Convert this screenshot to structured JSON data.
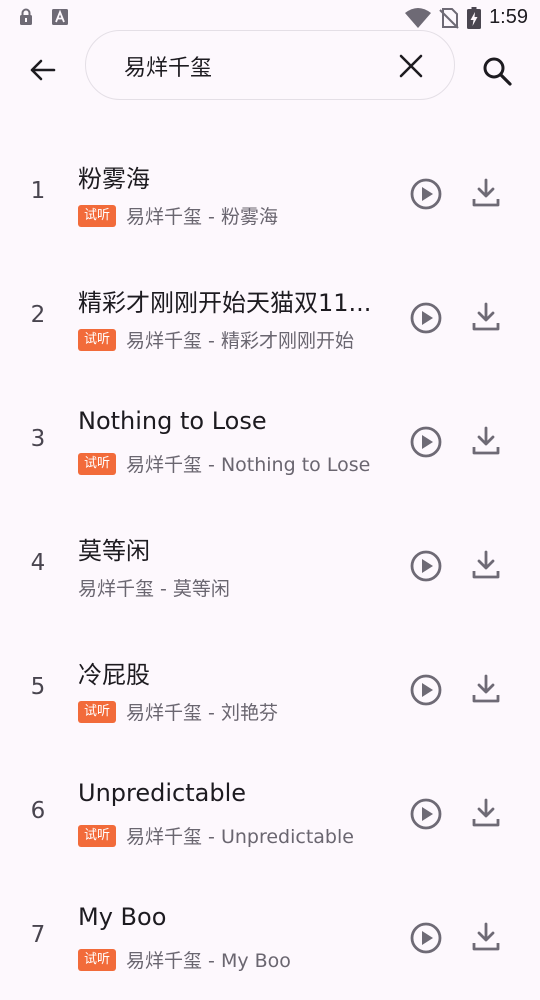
{
  "status_bar": {
    "time": "1:59",
    "icons": [
      "lock-icon",
      "a-icon",
      "wifi-icon",
      "no-sim-icon",
      "battery-charging-icon"
    ]
  },
  "search": {
    "back_icon": "arrow-left-icon",
    "value": "易烊千玺",
    "clear_icon": "close-icon",
    "search_icon": "search-icon"
  },
  "badge_label": "试听",
  "songs": [
    {
      "index": "1",
      "title": "粉雾海",
      "subtitle": "易烊千玺 - 粉雾海",
      "trial": true
    },
    {
      "index": "2",
      "title": "精彩才刚刚开始天猫双11...",
      "subtitle": "易烊千玺 - 精彩才刚刚开始",
      "trial": true
    },
    {
      "index": "3",
      "title": "Nothing to Lose",
      "subtitle": "易烊千玺 - Nothing to Lose",
      "trial": true
    },
    {
      "index": "4",
      "title": "莫等闲",
      "subtitle": "易烊千玺 - 莫等闲",
      "trial": false
    },
    {
      "index": "5",
      "title": "冷屁股",
      "subtitle": "易烊千玺 - 刘艳芬",
      "trial": true
    },
    {
      "index": "6",
      "title": "Unpredictable",
      "subtitle": "易烊千玺 - Unpredictable",
      "trial": true
    },
    {
      "index": "7",
      "title": "My Boo",
      "subtitle": "易烊千玺 - My Boo",
      "trial": true
    }
  ],
  "colors": {
    "background": "#fdf8fd",
    "badge": "#f26b3a",
    "icon": "#6e6a75",
    "text_primary": "#1d1b20",
    "text_secondary": "#6a6670"
  }
}
